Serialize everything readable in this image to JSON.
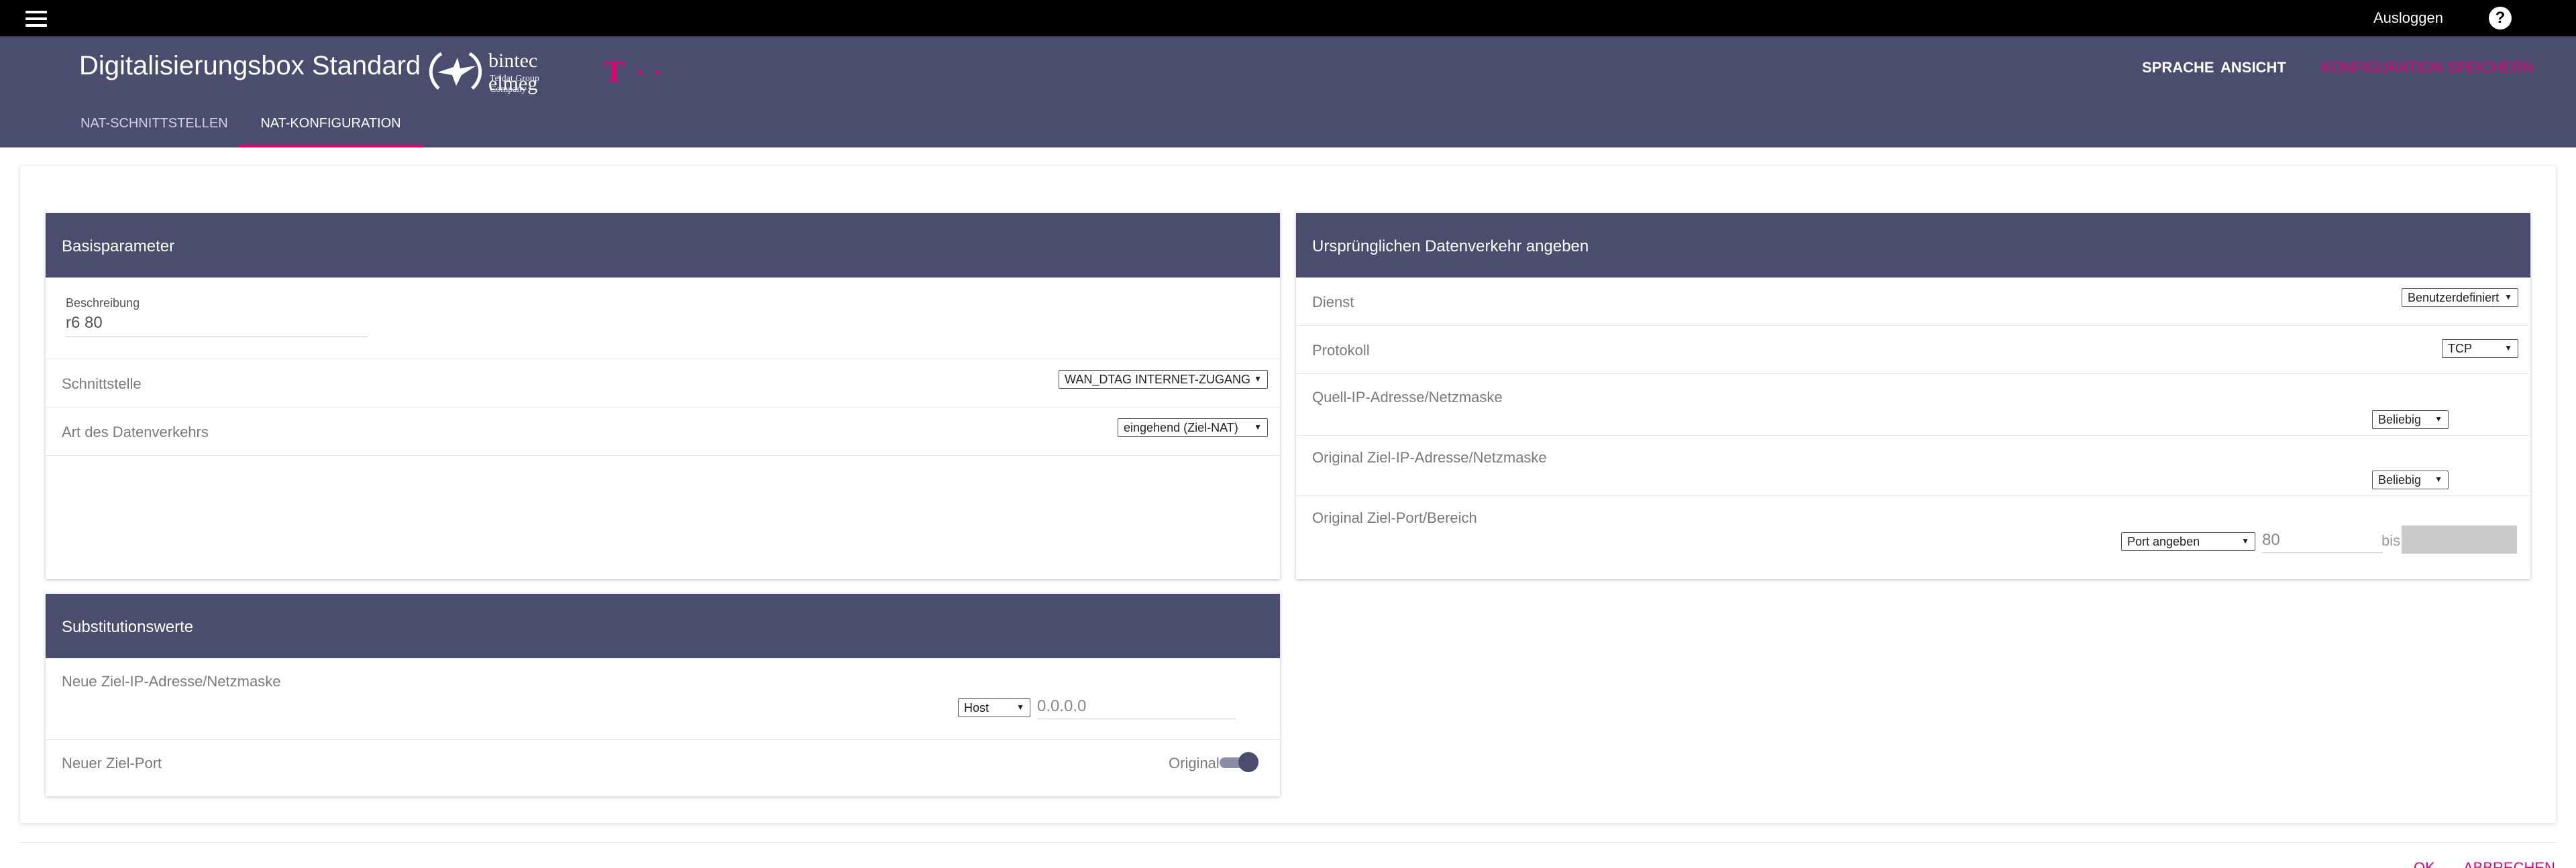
{
  "topbar": {
    "logout": "Ausloggen",
    "help": "?"
  },
  "header": {
    "title": "Digitalisierungsbox Standard",
    "brand_name": "bintec elmeg",
    "brand_sub": "Teldat Group Company",
    "t_logo": "T",
    "t_dots": "• •",
    "links": {
      "language": "SPRACHE",
      "view": "ANSICHT",
      "save": "KONFIGURATION SPEICHERN"
    },
    "tabs": [
      "NAT-SCHNITTSTELLEN",
      "NAT-KONFIGURATION"
    ],
    "active_tab": "NAT-KONFIGURATION"
  },
  "basis": {
    "title": "Basisparameter",
    "description_label": "Beschreibung",
    "description_value": "r6 80",
    "interface_label": "Schnittstelle",
    "interface_value": "WAN_DTAG INTERNET-ZUGANG",
    "traffic_label": "Art des Datenverkehrs",
    "traffic_value": "eingehend (Ziel-NAT)"
  },
  "original": {
    "title": "Ursprünglichen Datenverkehr angeben",
    "service_label": "Dienst",
    "service_value": "Benutzerdefiniert",
    "protocol_label": "Protokoll",
    "protocol_value": "TCP",
    "src_label": "Quell-IP-Adresse/Netzmaske",
    "src_value": "Beliebig",
    "dst_label": "Original Ziel-IP-Adresse/Netzmaske",
    "dst_value": "Beliebig",
    "port_label": "Original Ziel-Port/Bereich",
    "port_mode": "Port angeben",
    "port_value": "80",
    "port_to_label": "bis"
  },
  "subst": {
    "title": "Substitutionswerte",
    "new_ip_label": "Neue Ziel-IP-Adresse/Netzmaske",
    "new_ip_mode": "Host",
    "new_ip_value": "0.0.0.0",
    "new_port_label": "Neuer Ziel-Port",
    "new_port_toggle_label": "Original"
  },
  "footer": {
    "ok": "OK",
    "cancel": "ABBRECHEN"
  },
  "colors": {
    "header": "#4a4d6e",
    "accent": "#e20074"
  }
}
